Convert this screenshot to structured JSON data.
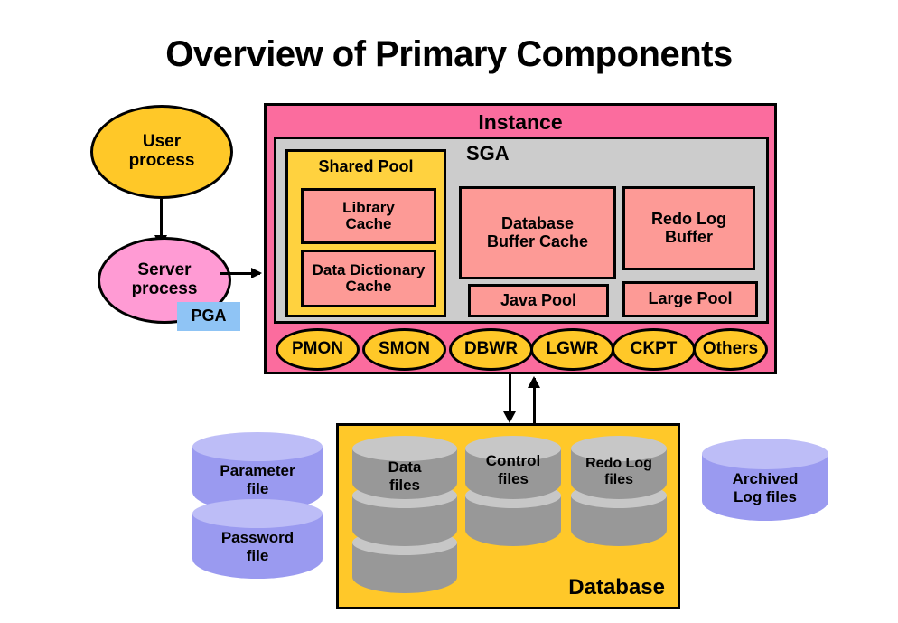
{
  "title": "Overview of Primary Components",
  "colors": {
    "instance_pink": "#FB6C9E",
    "sga_gray": "#CCCCCC",
    "shared_pool_yellow": "#FFD23F",
    "component_salmon": "#FD9A96",
    "pga_blue": "#8FC4F5",
    "database_yellow": "#FFC829",
    "user_process_gold": "#FFC828",
    "server_process_pink": "#FF9BD4",
    "bg_process_gold": "#FFC828",
    "file_purple": "#9A9AF0",
    "file_purple_top": "#BDBDF7",
    "disk_gray": "#989898",
    "disk_gray_top": "#C7C7C7",
    "outline": "#000000"
  },
  "processes": {
    "user_process": "User\nprocess",
    "user_process_line1": "User",
    "user_process_line2": "process",
    "server_process_line1": "Server",
    "server_process_line2": "process",
    "pga": "PGA"
  },
  "instance": {
    "label": "Instance",
    "sga": {
      "label": "SGA",
      "shared_pool": {
        "label": "Shared Pool",
        "caches": [
          {
            "line1": "Library",
            "line2": "Cache"
          },
          {
            "line1": "Data Dictionary",
            "line2": "Cache"
          }
        ]
      },
      "components": [
        {
          "name": "database-buffer-cache",
          "line1": "Database",
          "line2": "Buffer Cache"
        },
        {
          "name": "redo-log-buffer",
          "line1": "Redo Log",
          "line2": "Buffer"
        },
        {
          "name": "java-pool",
          "line1": "Java Pool",
          "line2": ""
        },
        {
          "name": "large-pool",
          "line1": "Large Pool",
          "line2": ""
        }
      ]
    },
    "background_processes": [
      "PMON",
      "SMON",
      "DBWR",
      "LGWR",
      "CKPT",
      "Others"
    ]
  },
  "database": {
    "label": "Database",
    "file_groups": [
      {
        "name": "data-files",
        "line1": "Data",
        "line2": "files",
        "discs": 3
      },
      {
        "name": "control-files",
        "line1": "Control",
        "line2": "files",
        "discs": 2
      },
      {
        "name": "redo-log-files",
        "line1": "Redo Log",
        "line2": "files",
        "discs": 2
      }
    ]
  },
  "external_files": {
    "left_stack": [
      {
        "name": "parameter-file",
        "line1": "Parameter",
        "line2": "file"
      },
      {
        "name": "password-file",
        "line1": "Password",
        "line2": "file"
      }
    ],
    "right": {
      "name": "archived-log-files",
      "line1": "Archived",
      "line2": "Log files"
    }
  },
  "arrows": {
    "user_to_server": "down-arrow",
    "server_to_instance": "right-arrow",
    "instance_to_db": "down-arrow",
    "db_to_instance": "up-arrow"
  }
}
